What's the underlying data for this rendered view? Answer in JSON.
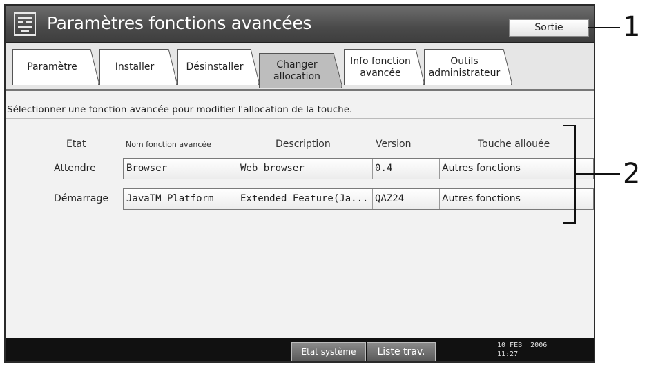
{
  "window": {
    "title": "Paramètres fonctions avancées",
    "exit_label": "Sortie"
  },
  "tabs": [
    {
      "label": "Paramètre",
      "active": false
    },
    {
      "label": "Installer",
      "active": false
    },
    {
      "label": "Désinstaller",
      "active": false
    },
    {
      "label": "Changer\nallocation",
      "active": true
    },
    {
      "label": "Info fonction\navancée",
      "active": false
    },
    {
      "label": "Outils\nadministrateur",
      "active": false
    }
  ],
  "instruction": "Sélectionner une fonction avancée pour modifier l'allocation de la touche.",
  "table": {
    "headers": {
      "state": "Etat",
      "name": "Nom fonction avancée",
      "description": "Description",
      "version": "Version",
      "key": "Touche allouée"
    },
    "rows": [
      {
        "state": "Attendre",
        "name": "Browser",
        "description": "Web browser",
        "version": "0.4",
        "key": "Autres fonctions"
      },
      {
        "state": "Démarrage",
        "name": "JavaTM Platform",
        "description": "Extended Feature(Ja...",
        "version": "QAZ24",
        "key": "Autres fonctions"
      }
    ]
  },
  "statusbar": {
    "system_status_label": "Etat système",
    "job_list_label": "Liste trav.",
    "date": "10 FEB  2006",
    "time": "11:27"
  },
  "callouts": {
    "one": "1",
    "two": "2"
  },
  "colors": {
    "titlebar": "#4a4a4a",
    "active_tab": "#bdbdbd",
    "statusbar": "#111111"
  }
}
